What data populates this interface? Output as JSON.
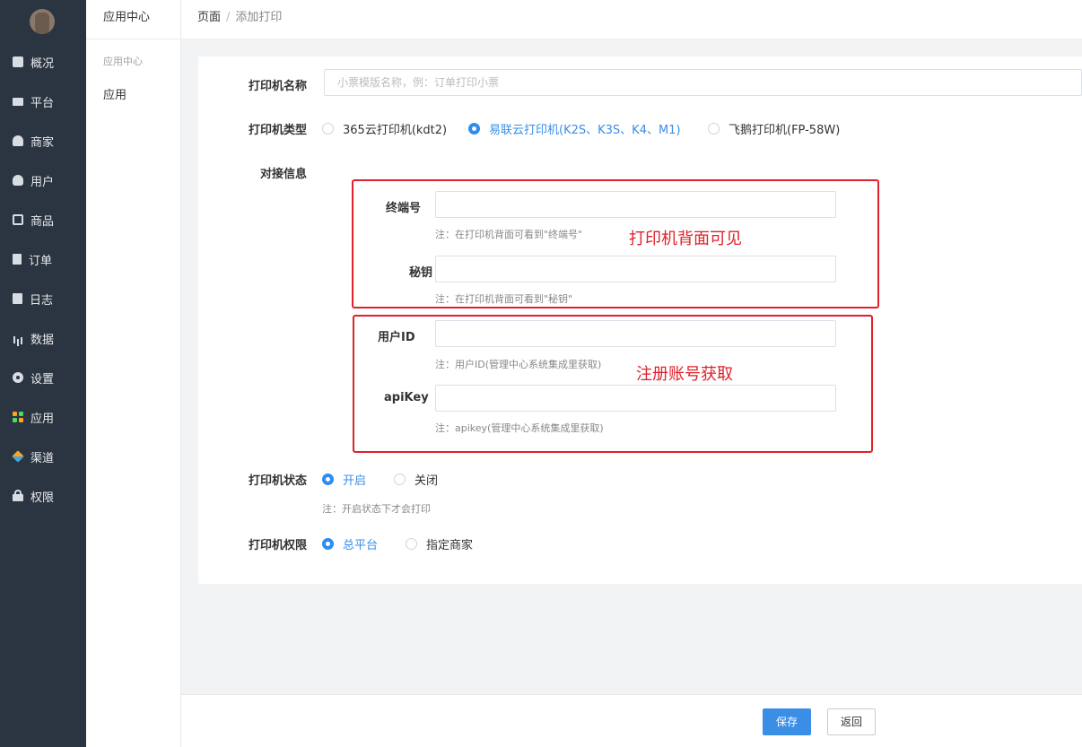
{
  "nav": [
    {
      "label": "概况",
      "icon": "dashboard-icon"
    },
    {
      "label": "平台",
      "icon": "monitor-icon"
    },
    {
      "label": "商家",
      "icon": "shop-icon"
    },
    {
      "label": "用户",
      "icon": "user-icon"
    },
    {
      "label": "商品",
      "icon": "goods-icon"
    },
    {
      "label": "订单",
      "icon": "order-icon"
    },
    {
      "label": "日志",
      "icon": "log-icon"
    },
    {
      "label": "数据",
      "icon": "chart-icon"
    },
    {
      "label": "设置",
      "icon": "gear-icon"
    },
    {
      "label": "应用",
      "icon": "apps-icon"
    },
    {
      "label": "渠道",
      "icon": "cube-icon"
    },
    {
      "label": "权限",
      "icon": "lock-icon"
    }
  ],
  "sub": {
    "title": "应用中心",
    "group": "应用中心",
    "item": "应用"
  },
  "breadcrumb": {
    "root": "页面",
    "separator": "/",
    "current": "添加打印"
  },
  "form": {
    "name_label": "打印机名称",
    "name_placeholder": "小票模版名称，例：订单打印小票",
    "type_label": "打印机类型",
    "type_options": [
      "365云打印机(kdt2)",
      "易联云打印机(K2S、K3S、K4、M1)",
      "飞鹅打印机(FP-58W)"
    ],
    "type_selected": 1,
    "docking_label": "对接信息",
    "terminal_label": "终端号",
    "terminal_note": "注：在打印机背面可看到\"终端号\"",
    "secret_label": "秘钥",
    "secret_note": "注：在打印机背面可看到\"秘钥\"",
    "userid_label": "用户ID",
    "userid_note": "注：用户ID(管理中心系统集成里获取)",
    "apikey_label": "apiKey",
    "apikey_note": "注：apikey(管理中心系统集成里获取)",
    "status_label": "打印机状态",
    "status_options": [
      "开启",
      "关闭"
    ],
    "status_selected": 0,
    "status_note": "注：开启状态下才会打印",
    "perm_label": "打印机权限",
    "perm_options": [
      "总平台",
      "指定商家"
    ],
    "perm_selected": 0
  },
  "annotations": {
    "box1_text": "打印机背面可见",
    "box2_text": "注册账号获取",
    "color": "#e0202a"
  },
  "buttons": {
    "save": "保存",
    "back": "返回"
  },
  "colors": {
    "sidebar": "#2b3541",
    "primary": "#3a8ee6"
  }
}
